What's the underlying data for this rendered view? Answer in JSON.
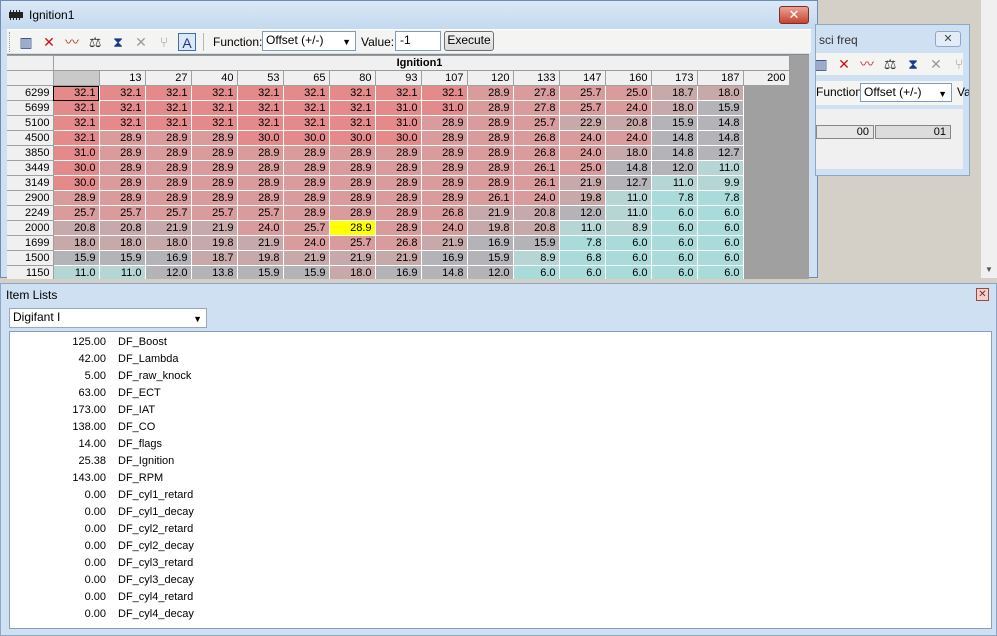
{
  "main_window": {
    "title": "Ignition1",
    "close_glyph": "✕",
    "toolbar": {
      "icons": [
        {
          "name": "chip-icon",
          "glyph": "▥",
          "color": "#1a3a8a"
        },
        {
          "name": "red-x-icon",
          "glyph": "✕",
          "color": "#d01010"
        },
        {
          "name": "graph-icon",
          "glyph": "〰",
          "color": "#c03030"
        },
        {
          "name": "scale-icon",
          "glyph": "⚖",
          "color": "#333333"
        },
        {
          "name": "triangle-icon",
          "glyph": "⧗",
          "color": "#1a3a8a"
        },
        {
          "name": "disabled-x-icon",
          "glyph": "✕",
          "color": "#9a9a9a"
        },
        {
          "name": "split-arrow-icon",
          "glyph": "⑂",
          "color": "#9a9a9a"
        },
        {
          "name": "font-a-icon",
          "glyph": "A",
          "color": "#1a3a8a"
        }
      ],
      "function_label": "Function:",
      "function_value": "Offset (+/-)",
      "value_label": "Value:",
      "value_input": "-1",
      "execute_label": "Execute"
    },
    "map": {
      "caption": "Ignition1",
      "columns": [
        "13",
        "27",
        "40",
        "53",
        "65",
        "80",
        "93",
        "107",
        "120",
        "133",
        "147",
        "160",
        "173",
        "187",
        "200"
      ],
      "rows": [
        {
          "rpm": "6299",
          "cells": [
            "32.1",
            "32.1",
            "32.1",
            "32.1",
            "32.1",
            "32.1",
            "32.1",
            "32.1",
            "32.1",
            "28.9",
            "27.8",
            "25.7",
            "25.0",
            "18.7",
            "18.0"
          ]
        },
        {
          "rpm": "5699",
          "cells": [
            "32.1",
            "32.1",
            "32.1",
            "32.1",
            "32.1",
            "32.1",
            "32.1",
            "31.0",
            "31.0",
            "28.9",
            "27.8",
            "25.7",
            "24.0",
            "18.0",
            "15.9"
          ]
        },
        {
          "rpm": "5100",
          "cells": [
            "32.1",
            "32.1",
            "32.1",
            "32.1",
            "32.1",
            "32.1",
            "32.1",
            "31.0",
            "28.9",
            "28.9",
            "25.7",
            "22.9",
            "20.8",
            "15.9",
            "14.8"
          ]
        },
        {
          "rpm": "4500",
          "cells": [
            "32.1",
            "28.9",
            "28.9",
            "28.9",
            "30.0",
            "30.0",
            "30.0",
            "30.0",
            "28.9",
            "28.9",
            "26.8",
            "24.0",
            "24.0",
            "14.8",
            "14.8"
          ]
        },
        {
          "rpm": "3850",
          "cells": [
            "31.0",
            "28.9",
            "28.9",
            "28.9",
            "28.9",
            "28.9",
            "28.9",
            "28.9",
            "28.9",
            "28.9",
            "26.8",
            "24.0",
            "18.0",
            "14.8",
            "12.7"
          ]
        },
        {
          "rpm": "3449",
          "cells": [
            "30.0",
            "28.9",
            "28.9",
            "28.9",
            "28.9",
            "28.9",
            "28.9",
            "28.9",
            "28.9",
            "28.9",
            "26.1",
            "25.0",
            "14.8",
            "12.0",
            "11.0"
          ]
        },
        {
          "rpm": "3149",
          "cells": [
            "30.0",
            "28.9",
            "28.9",
            "28.9",
            "28.9",
            "28.9",
            "28.9",
            "28.9",
            "28.9",
            "28.9",
            "26.1",
            "21.9",
            "12.7",
            "11.0",
            "9.9"
          ]
        },
        {
          "rpm": "2900",
          "cells": [
            "28.9",
            "28.9",
            "28.9",
            "28.9",
            "28.9",
            "28.9",
            "28.9",
            "28.9",
            "28.9",
            "26.1",
            "24.0",
            "19.8",
            "11.0",
            "7.8",
            "7.8"
          ]
        },
        {
          "rpm": "2249",
          "cells": [
            "25.7",
            "25.7",
            "25.7",
            "25.7",
            "25.7",
            "28.9",
            "28.9",
            "28.9",
            "26.8",
            "21.9",
            "20.8",
            "12.0",
            "11.0",
            "6.0",
            "6.0"
          ]
        },
        {
          "rpm": "2000",
          "cells": [
            "20.8",
            "20.8",
            "21.9",
            "21.9",
            "24.0",
            "25.7",
            "28.9",
            "28.9",
            "24.0",
            "19.8",
            "20.8",
            "11.0",
            "8.9",
            "6.0",
            "6.0"
          ]
        },
        {
          "rpm": "1699",
          "cells": [
            "18.0",
            "18.0",
            "18.0",
            "19.8",
            "21.9",
            "24.0",
            "25.7",
            "26.8",
            "21.9",
            "16.9",
            "15.9",
            "7.8",
            "6.0",
            "6.0",
            "6.0"
          ]
        },
        {
          "rpm": "1500",
          "cells": [
            "15.9",
            "15.9",
            "16.9",
            "18.7",
            "19.8",
            "21.9",
            "21.9",
            "21.9",
            "16.9",
            "15.9",
            "8.9",
            "6.8",
            "6.0",
            "6.0",
            "6.0"
          ]
        },
        {
          "rpm": "1150",
          "cells": [
            "11.0",
            "11.0",
            "12.0",
            "13.8",
            "15.9",
            "15.9",
            "18.0",
            "16.9",
            "14.8",
            "12.0",
            "6.0",
            "6.0",
            "6.0",
            "6.0",
            "6.0"
          ]
        }
      ],
      "highlight": {
        "row": 9,
        "col": 6
      }
    }
  },
  "sci_window": {
    "title": "sci freq",
    "close_glyph": "✕",
    "function_label": "Function:",
    "function_value": "Offset (+/-)",
    "value_label": "Va",
    "cell_a": "00",
    "cell_b": "01"
  },
  "item_lists": {
    "title": "Item Lists",
    "close_glyph": "✕",
    "dropdown_value": "Digifant I",
    "items": [
      {
        "value": "125.00",
        "name": "DF_Boost"
      },
      {
        "value": "42.00",
        "name": "DF_Lambda"
      },
      {
        "value": "5.00",
        "name": "DF_raw_knock"
      },
      {
        "value": "63.00",
        "name": "DF_ECT"
      },
      {
        "value": "173.00",
        "name": "DF_IAT"
      },
      {
        "value": "138.00",
        "name": "DF_CO"
      },
      {
        "value": "14.00",
        "name": "DF_flags"
      },
      {
        "value": "25.38",
        "name": "DF_Ignition"
      },
      {
        "value": "143.00",
        "name": "DF_RPM"
      },
      {
        "value": "0.00",
        "name": "DF_cyl1_retard"
      },
      {
        "value": "0.00",
        "name": "DF_cyl1_decay"
      },
      {
        "value": "0.00",
        "name": "DF_cyl2_retard"
      },
      {
        "value": "0.00",
        "name": "DF_cyl2_decay"
      },
      {
        "value": "0.00",
        "name": "DF_cyl3_retard"
      },
      {
        "value": "0.00",
        "name": "DF_cyl3_decay"
      },
      {
        "value": "0.00",
        "name": "DF_cyl4_retard"
      },
      {
        "value": "0.00",
        "name": "DF_cyl4_decay"
      }
    ]
  }
}
